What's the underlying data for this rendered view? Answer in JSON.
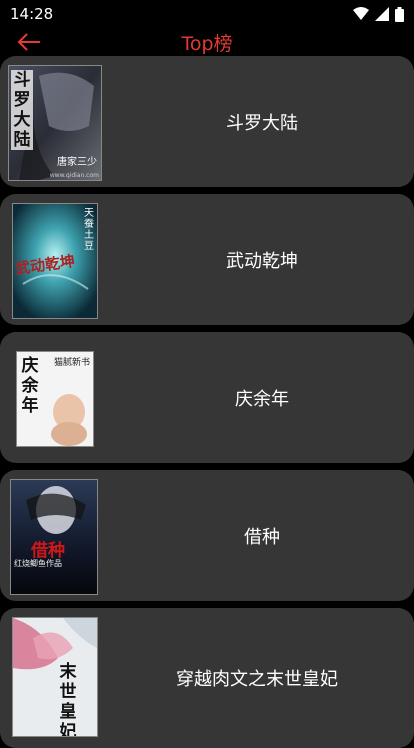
{
  "status": {
    "time": "14:28"
  },
  "header": {
    "title": "Top榜"
  },
  "books": [
    {
      "title": "斗罗大陆",
      "cover_text": "斗罗大陆",
      "cover_sub": "唐家三少",
      "cover_site": "www.qidian.com"
    },
    {
      "title": "武动乾坤",
      "cover_text": "武动乾坤",
      "cover_sub": "天蚕土豆"
    },
    {
      "title": "庆余年",
      "cover_text": "庆余年",
      "cover_sub": "猫腻新书"
    },
    {
      "title": "借种",
      "cover_text": "借种",
      "cover_sub": "红烧鲫鱼作品"
    },
    {
      "title": "穿越肉文之末世皇妃",
      "cover_text": "末世皇妃"
    }
  ],
  "colors": {
    "accent": "#e53935",
    "card": "#363636",
    "background": "#000000"
  }
}
